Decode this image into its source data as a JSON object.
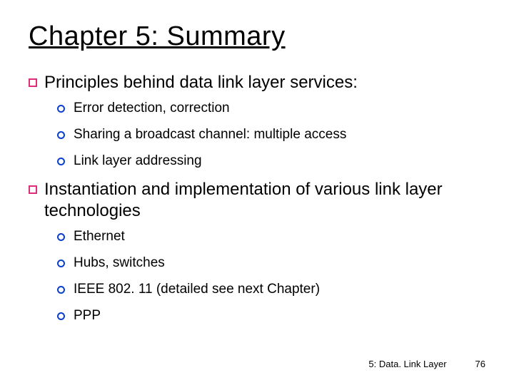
{
  "title": "Chapter 5: Summary",
  "items": [
    {
      "text": "Principles behind data link layer services:",
      "subs": [
        "Error detection, correction",
        "Sharing a broadcast channel: multiple access",
        "Link layer addressing"
      ]
    },
    {
      "text": "Instantiation and implementation of various link layer technologies",
      "subs": [
        "Ethernet",
        "Hubs, switches",
        "IEEE 802. 11 (detailed see next Chapter)",
        "PPP"
      ]
    }
  ],
  "footer": {
    "label": "5: Data. Link Layer",
    "page": "76"
  }
}
